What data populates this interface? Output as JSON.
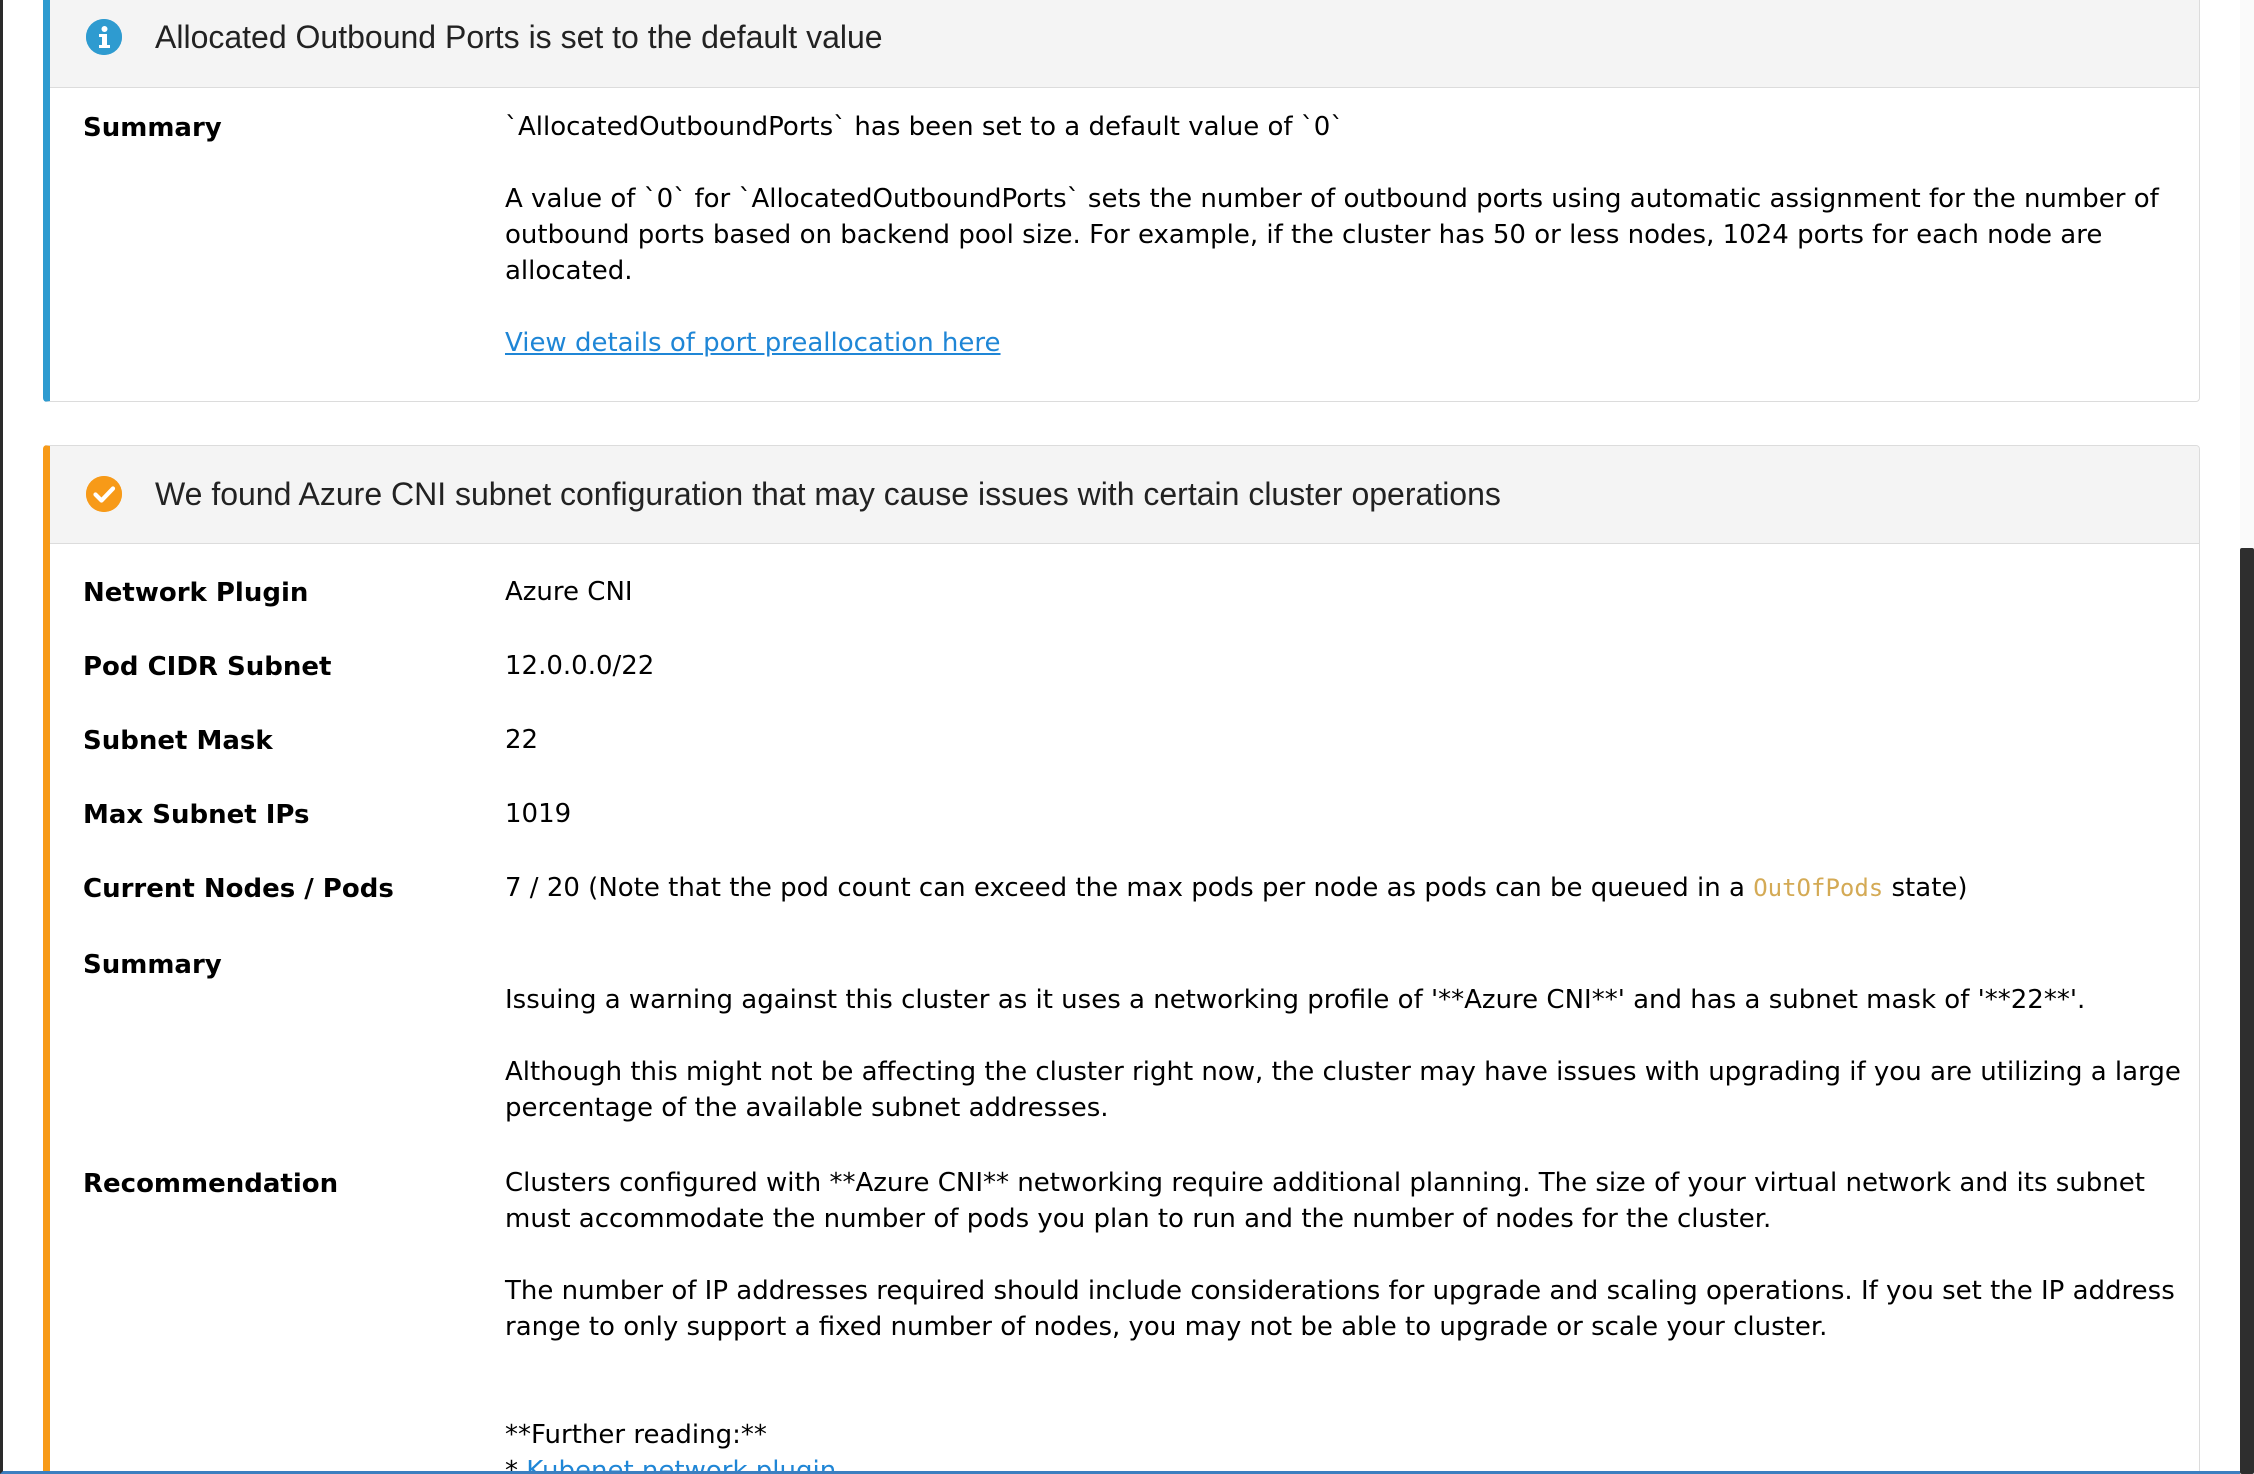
{
  "colors": {
    "info_accent": "#2e9bd0",
    "warning_accent": "#f79a18",
    "link": "#1f86d6",
    "code": "#d4aa55"
  },
  "info_card": {
    "icon": "info-circle-icon",
    "title": "Allocated Outbound Ports is set to the default value",
    "summary_label": "Summary",
    "summary_line1": "`AllocatedOutboundPorts` has been set to a default value of `0`",
    "summary_line2": "A value of `0` for `AllocatedOutboundPorts` sets the number of outbound ports using automatic assignment for the number of outbound ports based on backend pool size. For example, if the cluster has 50 or less nodes, 1024 ports for each node are allocated.",
    "link_text": "View details of port preallocation here"
  },
  "warning_card": {
    "icon": "check-circle-icon",
    "title": "We found Azure CNI subnet configuration that may cause issues with certain cluster operations",
    "network_plugin_label": "Network Plugin",
    "network_plugin_value": "Azure CNI",
    "pod_cidr_label": "Pod CIDR Subnet",
    "pod_cidr_value": "12.0.0.0/22",
    "subnet_mask_label": "Subnet Mask",
    "subnet_mask_value": "22",
    "max_ips_label": "Max Subnet IPs",
    "max_ips_value": "1019",
    "nodes_pods_label": "Current Nodes / Pods",
    "nodes_pods_prefix": "7 / 20 (Note that the pod count can exceed the max pods per node as pods can be queued in a ",
    "nodes_pods_code": "OutOfPods",
    "nodes_pods_suffix": " state)",
    "summary_label": "Summary",
    "summary_line1": "Issuing a warning against this cluster as it uses a networking profile of '**Azure CNI**' and has a subnet mask of '**22**'.",
    "summary_line2": "Although this might not be affecting the cluster right now, the cluster may have issues with upgrading if you are utilizing a large percentage of the available subnet addresses.",
    "recommendation_label": "Recommendation",
    "recommendation_line1": "Clusters configured with **Azure CNI** networking require additional planning. The size of your virtual network and its subnet must accommodate the number of pods you plan to run and the number of nodes for the cluster.",
    "recommendation_line2": "The number of IP addresses required should include considerations for upgrade and scaling operations. If you set the IP address range to only support a fixed number of nodes, you may not be able to upgrade or scale your cluster.",
    "further_reading": "**Further reading:**",
    "further_link_bullet": "* ",
    "further_link_text": "Kubenet network plugin"
  }
}
